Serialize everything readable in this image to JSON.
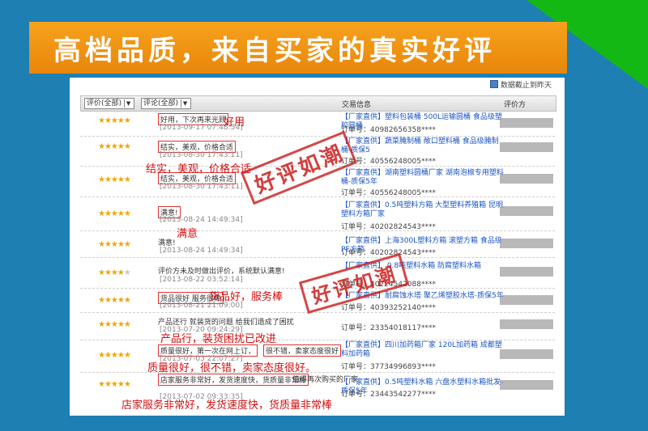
{
  "banner": {
    "title": "高档品质，来自买家的真实好评"
  },
  "panel": {
    "note": "数据截止到昨天",
    "header": {
      "rating_filter": "评价(全部)",
      "comment_filter": "评论(全部)",
      "trade_info": "交易信息",
      "rater": "评价方"
    }
  },
  "rows": [
    {
      "stars": 5,
      "comment": "好用，下次再来光顾",
      "date": "[2013-09-17 07:48:54]",
      "product": "【厂家直供】塑料包装桶 500L运输圆桶 食品级塑胶圆桶",
      "order": "订单号：40982656358****"
    },
    {
      "stars": 5,
      "comment": "结实，美观，价格合适",
      "date": "[2013-08-30 17:43:11]",
      "product": "【厂家直供】蔬菜腌制桶 敞口塑料桶 食品级腌制桶-质保5",
      "order": "订单号：40556248005****"
    },
    {
      "stars": 5,
      "comment": "结实，美观，价格合适",
      "date": "[2013-08-30 17:43:11]",
      "product": "【厂家直供】湖南塑料圆桶厂家 湖南泡椒专用塑料桶-质保5年",
      "order": "订单号：40556248005****"
    },
    {
      "stars": 5,
      "comment": "满意!",
      "date": "[2013-08-24 14:49:34]",
      "product": "【厂家直供】0.5吨塑料方箱 大型塑料养殖箱 昆明塑料方箱厂家",
      "order": "订单号：40202824543****"
    },
    {
      "stars": 5,
      "comment": "满意!",
      "date": "[2013-08-24 14:49:34]",
      "product": "【厂家直供】上海300L塑料方箱 滚塑方箱 食品级PE方箱",
      "order": "订单号：40202824543****"
    },
    {
      "stars": 4,
      "comment": "评价方未及时做出评价，系统默认满意!",
      "date": "[2013-08-22 03:52:14]",
      "product": "【厂家直供】 0.8吨塑料水箱 防腐塑料水箱",
      "order": "订单号：40224542088****"
    },
    {
      "stars": 5,
      "comment": "货品很好 服务很棒",
      "date": "[2013-08-21 21:09:00]",
      "product": "【厂家直供】耐腐蚀水塔 聚乙烯塑胶水塔-质保5年",
      "order": "订单号：40393252140****"
    },
    {
      "stars": 5,
      "comment": "产品还行 就装货的问题 给我们造成了困扰",
      "date": "[2013-07-20 09:24:29]",
      "product": "",
      "order": "订单号：23354018117****"
    },
    {
      "stars": 5,
      "comment": "质量很好，第一次在网上订，",
      "comment2": "很不错，卖家态度很好",
      "date": "[2013-07-03 22:07:27]",
      "product": "【厂家直供】四川加药箱厂家 120L加药箱 成都塑料加药箱",
      "order": "订单号：37734996893****"
    },
    {
      "stars": 5,
      "comment": "店家服务非常好，发货速度快，货质量非常棒",
      "comment_tail": "值得再次购买的厂家",
      "date": "[2013-07-02 09:33:35]",
      "product": "【厂家直供】0.5吨塑料水箱 六盘水塑料水箱批发-质保5年",
      "order": "订单号：23443542277****"
    }
  ],
  "annotations": [
    "好用",
    "结实，美观，价格合适",
    "满意",
    "货品好，服务棒",
    "产品行，装货困扰已改进",
    "质量很好，很不错，卖家态度很好。",
    "店家服务非常好，发货速度快，货质量非常棒"
  ],
  "stamps": [
    "好评如潮",
    "好评如潮"
  ]
}
